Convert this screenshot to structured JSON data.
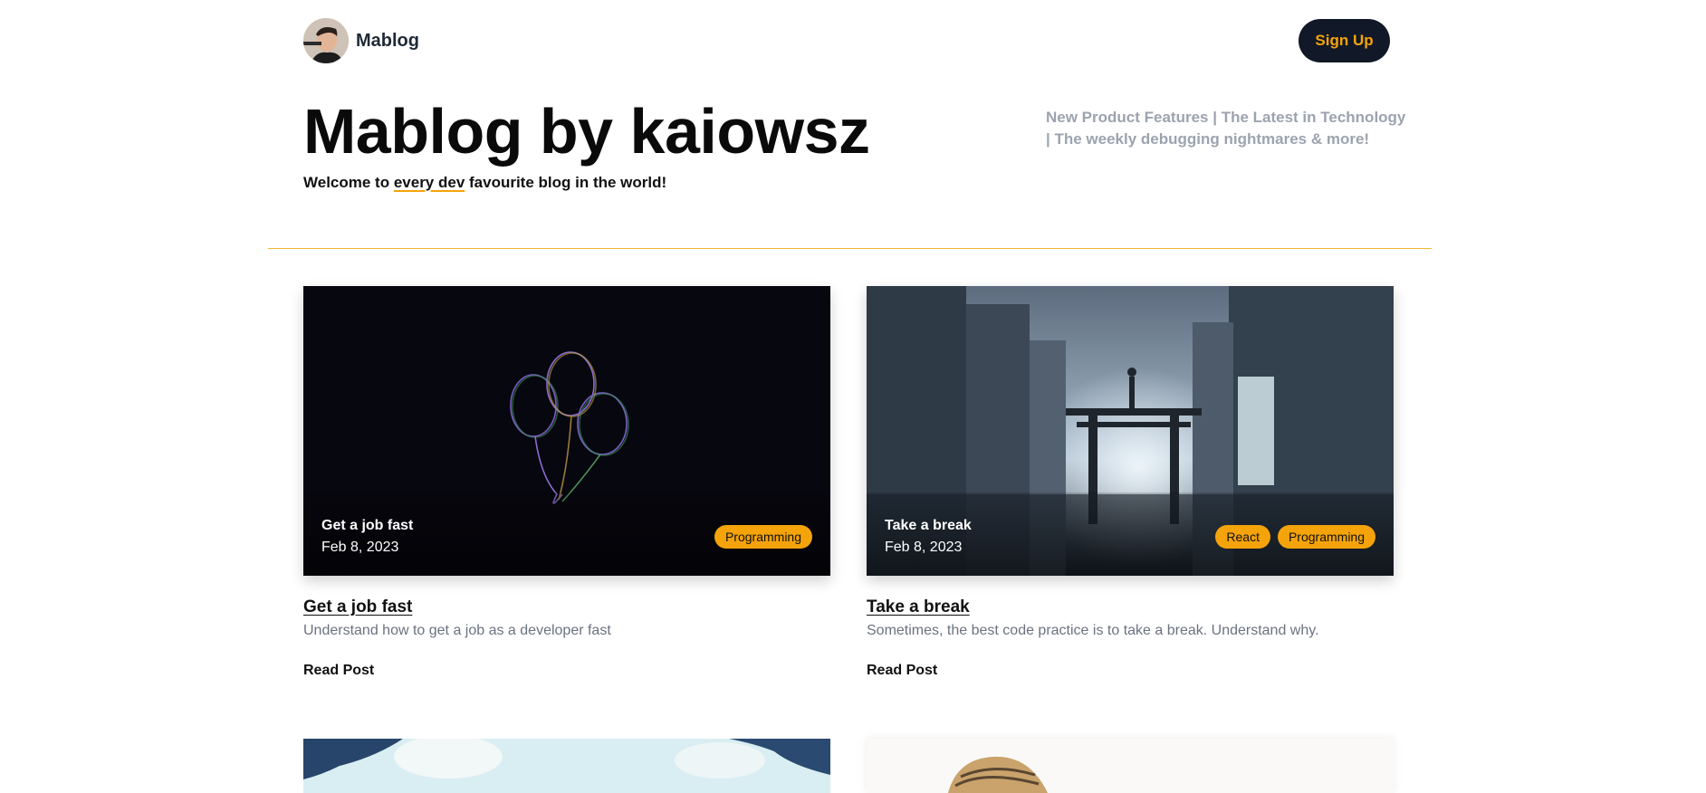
{
  "nav": {
    "brand": "Mablog",
    "signup_label": "Sign Up"
  },
  "hero": {
    "title": "Mablog by kaiowsz",
    "subtitle_pre": "Welcome to ",
    "subtitle_highlight": "every dev",
    "subtitle_post": " favourite blog in the world!",
    "tagline": "New Product Features | The Latest in Technology | The weekly debugging nightmares & more!"
  },
  "posts": [
    {
      "title": "Get a job fast",
      "date": "Feb 8, 2023",
      "tags": [
        "Programming"
      ],
      "description": "Understand how to get a job as a developer fast",
      "read_label": "Read Post"
    },
    {
      "title": "Take a break",
      "date": "Feb 8, 2023",
      "tags": [
        "React",
        "Programming"
      ],
      "description": "Sometimes, the best code practice is to take a break. Understand why.",
      "read_label": "Read Post"
    }
  ],
  "colors": {
    "accent": "#f5a30b",
    "dark": "#111827",
    "muted": "#9ca3af"
  }
}
